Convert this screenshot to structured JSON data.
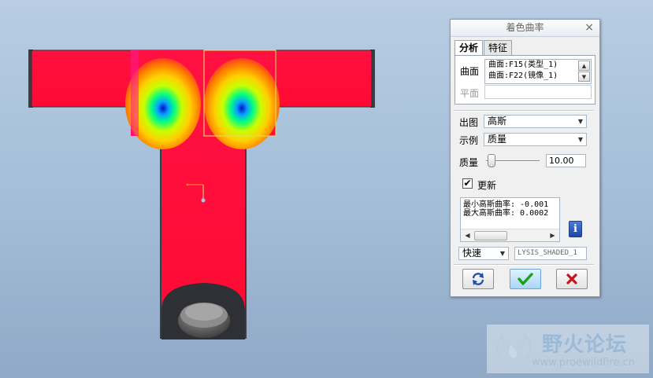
{
  "dialog": {
    "title": "着色曲率",
    "close_glyph": "×",
    "tabs": [
      {
        "label": "分析"
      },
      {
        "label": "特征"
      }
    ],
    "surface_label": "曲面",
    "surfaces": [
      "曲面:F15(类型_1)",
      "曲面:F22(镜像_1)"
    ],
    "plane_label": "平面",
    "output_label": "出图",
    "output_value": "高斯",
    "display_label": "示例",
    "display_value": "质量",
    "quality_label": "质量",
    "quality_value": "10.00",
    "update_label": "更新",
    "update_checked": true,
    "results": [
      "最小高斯曲率: -0.001",
      "最大高斯曲率: 0.0002"
    ],
    "mode_value": "快速",
    "analysis_name": "LYSIS_SHADED_1",
    "buttons": {
      "repeat_icon": "repeat-icon",
      "ok_icon": "checkmark-icon",
      "cancel_icon": "cross-icon"
    }
  },
  "watermark": {
    "title": "野火论坛",
    "url": "www.proewildfire.cn"
  },
  "colors": {
    "part_red": "#ff0a3a",
    "ok_green": "#1aa31a",
    "cancel_red": "#c4151b",
    "dialog_bg": "#f0f0f0"
  }
}
